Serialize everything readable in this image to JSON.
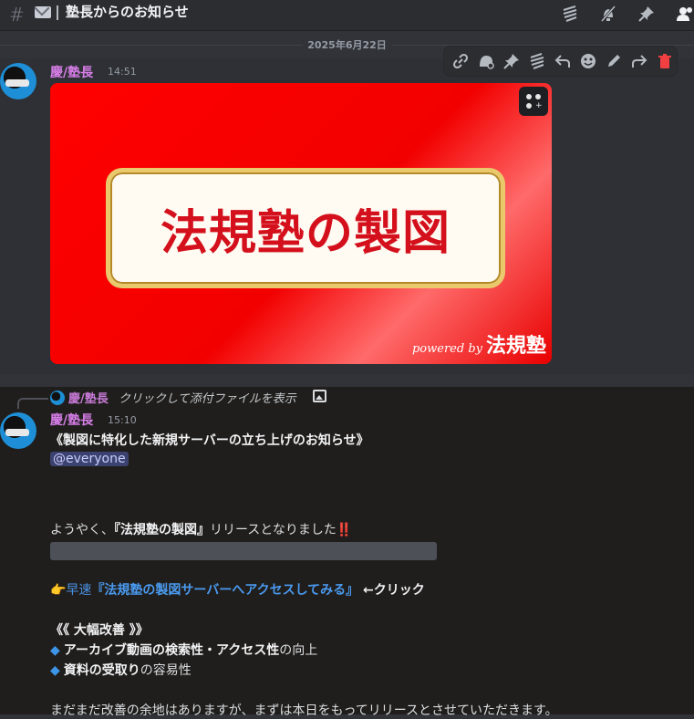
{
  "header": {
    "channel_title": "塾長からのお知らせ",
    "icons": [
      "threads-icon",
      "mute-icon",
      "pin-icon",
      "members-icon"
    ]
  },
  "date_divider": "2025年6月22日",
  "message1": {
    "author": "慶/塾長",
    "time": "14:51",
    "attachment": {
      "title_text": "法規塾の製図",
      "powered_by": "powered by",
      "brand": "法規塾"
    }
  },
  "hover_toolbar": {
    "icons": [
      "link-icon",
      "add-reaction-icon",
      "pin-icon",
      "thread-icon",
      "reply-icon",
      "emoji-icon",
      "edit-icon",
      "forward-icon",
      "delete-icon"
    ]
  },
  "message2": {
    "reply": {
      "author": "慶/塾長",
      "text": "クリックして添付ファイルを表示"
    },
    "author": "慶/塾長",
    "time": "15:10",
    "heading": "《製図に特化した新規サーバーの立ち上げのお知らせ》",
    "mention": "@everyone",
    "release_pre": "ようやく、",
    "release_bold": "『法規塾の製図』",
    "release_post": "リリースとなりました",
    "release_mark": "‼️",
    "hand": "👉",
    "quick": "早速",
    "link_text": "『法規塾の製図サーバーへアクセスしてみる』",
    "click_note": " ←クリック",
    "improve_heading": "《《 大幅改善 》》",
    "bullets": [
      {
        "bold": "アーカイブ動画の検索性・アクセス性",
        "rest": "の向上"
      },
      {
        "bold": "資料の受取り",
        "rest": "の容易性"
      }
    ],
    "closing": "まだまだ改善の余地はありますが、まずは本日をもってリリースとさせていただきます。"
  },
  "colors": {
    "background": "#313338",
    "username": "#d77ee8",
    "link": "#4a90e2",
    "danger": "#f23f42",
    "banner_red": "#ff0000"
  }
}
